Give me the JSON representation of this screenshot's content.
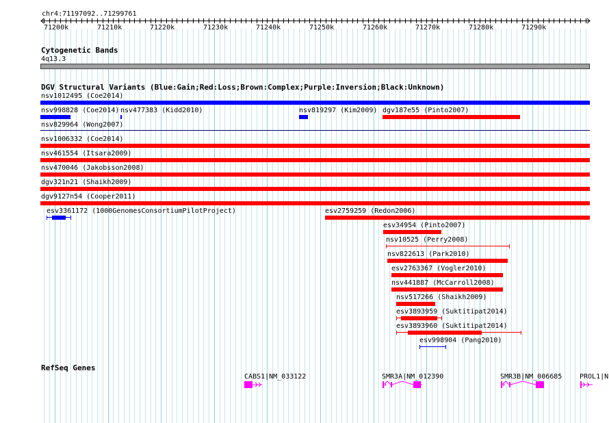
{
  "ruler": {
    "position": "chr4:71197092..71299761",
    "ticks": [
      "71200k",
      "71210k",
      "71220k",
      "71230k",
      "71240k",
      "71250k",
      "71260k",
      "71270k",
      "71280k",
      "71290k"
    ]
  },
  "cytoband": {
    "title": "Cytogenetic Bands",
    "band": "4q13.3"
  },
  "dgv": {
    "title": "DGV Structural Variants (Blue:Gain;Red:Loss;Brown:Complex;Purple:Inversion;Black:Unknown)",
    "colors": {
      "gain": "#0000ff",
      "loss": "#ff0000",
      "line": "#000080"
    },
    "labels": [
      "nsv1012495 (Coe2014)",
      "nsv998828 (Coe2014)",
      "nsv477383 (Kidd2010)",
      "nsv819297 (Kim2009)",
      "dgv187e55 (Pinto2007)",
      "nsv829964 (Wong2007)",
      "nsv1006332 (Coe2014)",
      "nsv461554 (Itsara2009)",
      "nsv470046 (Jakobsson2008)",
      "dgv321n21 (Shaikh2009)",
      "dgv9127n54 (Cooper2011)",
      "esv3361172 (1000GenomesConsortiumPilotProject)",
      "esv2759259 (Redon2006)",
      "esv34954 (Pinto2007)",
      "nsv10525 (Perry2008)",
      "nsv822613 (Park2010)",
      "esv2763367 (Vogler2010)",
      "nsv441887 (McCarroll2008)",
      "nsv517266 (Shaikh2009)",
      "esv3893959 (Suktitipat2014)",
      "esv3893960 (Suktitipat2014)",
      "esv998904 (Pang2010)"
    ]
  },
  "refseq": {
    "title": "RefSeq Genes",
    "gene_color": "#ff00ff",
    "genes": [
      "CABS1|NM_033122",
      "SMR3A|NM_012390",
      "SMR3B|NM_006685",
      "PROL1|N"
    ]
  }
}
